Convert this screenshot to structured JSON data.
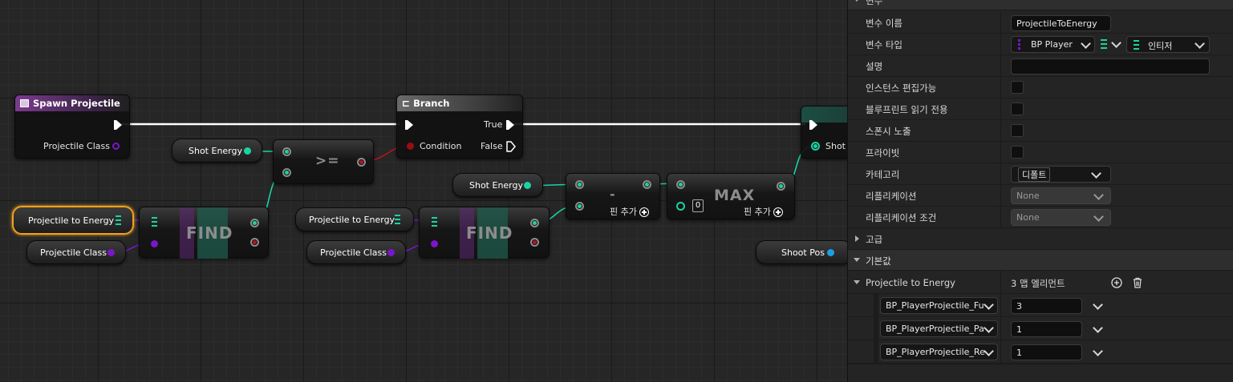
{
  "graph": {
    "spawn_node": {
      "title": "Spawn Projectile",
      "pin_class": "Projectile Class"
    },
    "branch_node": {
      "title": "Branch",
      "pin_condition": "Condition",
      "pin_true": "True",
      "pin_false": "False"
    },
    "right_node": {
      "pin_partial": "Shot"
    },
    "getters": {
      "shot_energy_1": "Shot Energy",
      "shot_energy_2": "Shot Energy",
      "proj_to_energy_1": "Projectile to Energy",
      "proj_to_energy_2": "Projectile to Energy",
      "proj_class_1": "Projectile Class",
      "proj_class_2": "Projectile Class",
      "shoot_pos": "Shoot Pos"
    },
    "ops": {
      "compare": ">=",
      "find_1": "FIND",
      "find_2": "FIND",
      "subtract": "-",
      "max": "MAX",
      "add_pin": "핀 추가",
      "max_default": "0"
    }
  },
  "details": {
    "section_variable": "변수",
    "rows": {
      "var_name_label": "변수 이름",
      "var_name_value": "ProjectileToEnergy",
      "var_type_label": "변수 타입",
      "var_type_key": "BP Player",
      "var_type_value": "인티저",
      "description_label": "설명",
      "description_value": "",
      "instance_editable_label": "인스턴스 편집가능",
      "blueprint_readonly_label": "블루프린트 읽기 전용",
      "expose_spawn_label": "스폰시 노출",
      "private_label": "프라이빗",
      "category_label": "카테고리",
      "category_value": "디폴트",
      "replication_label": "리플리케이션",
      "replication_value": "None",
      "replication_condition_label": "리플리케이션 조건",
      "replication_condition_value": "None"
    },
    "section_advanced": "고급",
    "section_default": "기본값",
    "default_value": {
      "label": "Projectile to Energy",
      "summary": "3 맵 엘리먼트",
      "entries": [
        {
          "key": "BP_PlayerProjectile_Fu",
          "value": "3"
        },
        {
          "key": "BP_PlayerProjectile_Pa",
          "value": "1"
        },
        {
          "key": "BP_PlayerProjectile_Re",
          "value": "1"
        }
      ]
    },
    "colors": {
      "teal": "#1bd3a2",
      "purple": "#7b16c9",
      "exec": "#ffffff",
      "bool": "#9a0d12",
      "vector": "#1aa0e6"
    }
  }
}
